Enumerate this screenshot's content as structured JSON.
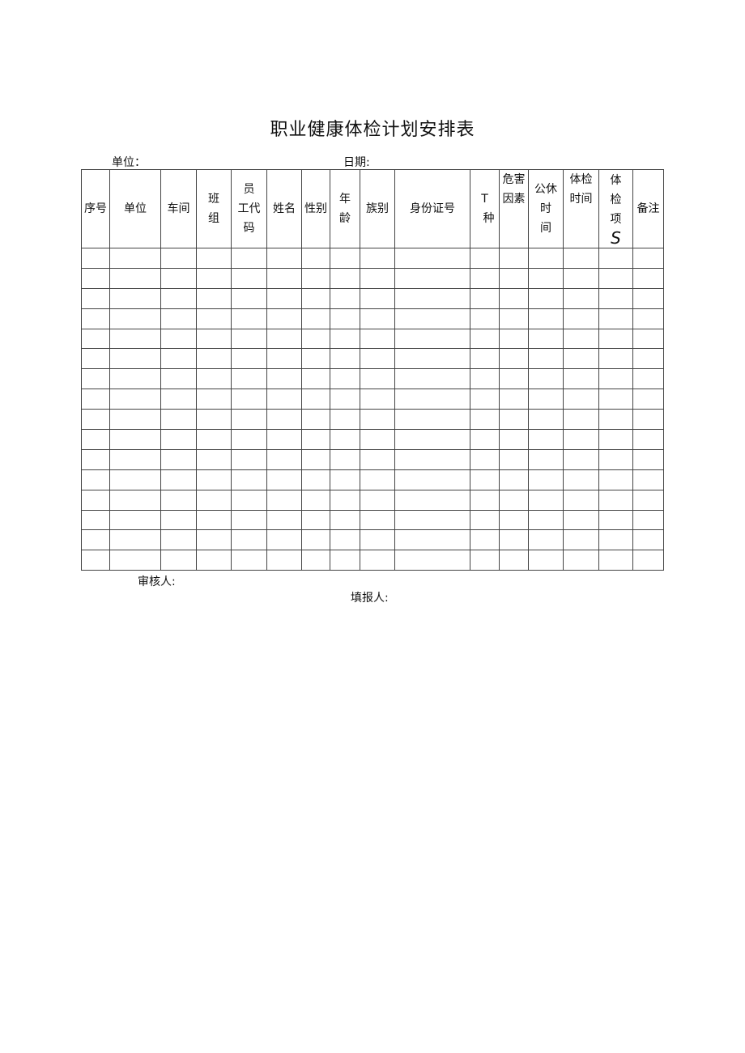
{
  "title": "职业健康体检计划安排表",
  "labels": {
    "unit": "单位：",
    "date": "日期:",
    "reviewer": "审核人:",
    "filler": "填报人:"
  },
  "columns": [
    {
      "lines": [
        "序号"
      ]
    },
    {
      "lines": [
        "单位"
      ]
    },
    {
      "lines": [
        "车间"
      ]
    },
    {
      "lines": [
        "班",
        "组"
      ]
    },
    {
      "lines": [
        "员",
        "工代",
        "码"
      ]
    },
    {
      "lines": [
        "姓名"
      ]
    },
    {
      "lines": [
        "性别"
      ]
    },
    {
      "lines": [
        "年",
        "龄"
      ]
    },
    {
      "lines": [
        "族别"
      ]
    },
    {
      "lines": [
        "身份证号"
      ]
    },
    {
      "lines": [
        "T",
        "种"
      ]
    },
    {
      "lines": [
        "危害",
        "因素"
      ]
    },
    {
      "lines": [
        "公休",
        "时",
        "间"
      ]
    },
    {
      "lines": [
        "体检",
        "时间"
      ]
    },
    {
      "lines": [
        "体",
        "检",
        "项",
        "S"
      ]
    },
    {
      "lines": [
        "备注"
      ]
    }
  ],
  "row_count": 16
}
